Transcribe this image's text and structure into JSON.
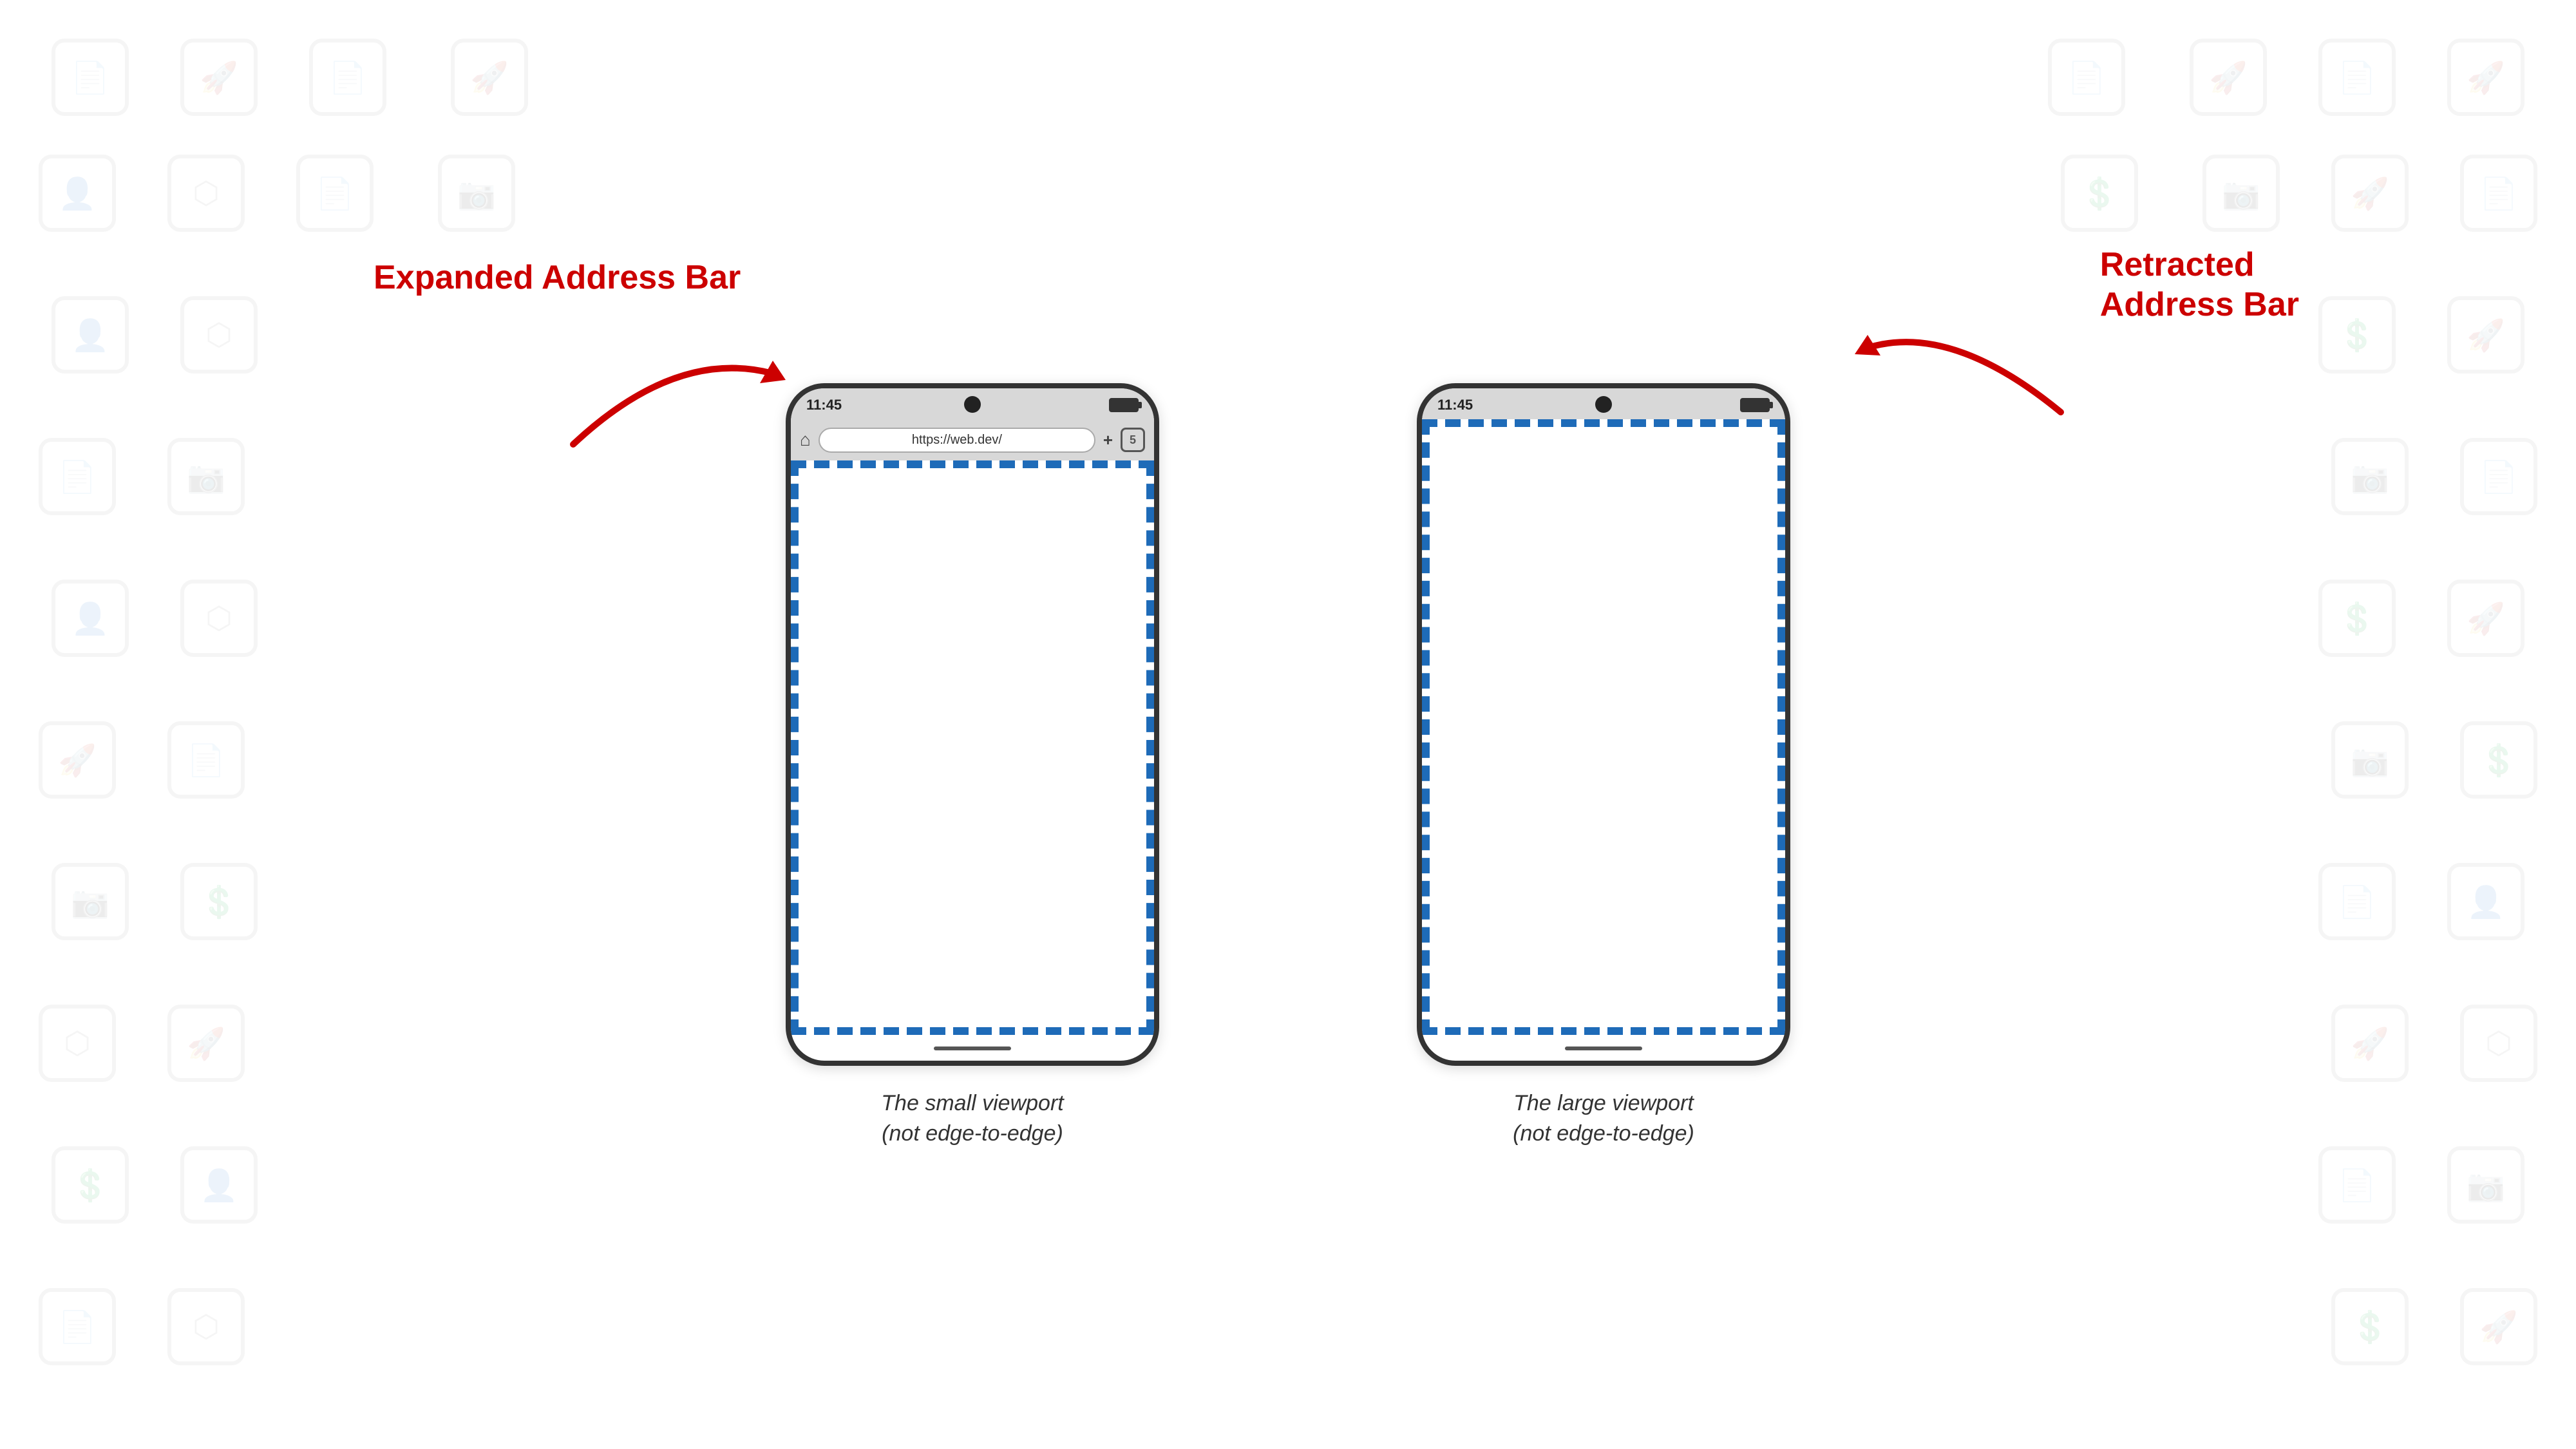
{
  "background": {
    "color": "#ffffff",
    "icon_opacity": 0.08
  },
  "left_phone": {
    "label": "Expanded\nAddress Bar",
    "time": "11:45",
    "url": "https://web.dev/",
    "tabs_count": "5",
    "caption_line1": "The small viewport",
    "caption_line2": "(not edge-to-edge)",
    "has_address_bar": true,
    "address_bar_visible": true
  },
  "right_phone": {
    "label": "Retracted\nAddress Bar",
    "time": "11:45",
    "caption_line1": "The large viewport",
    "caption_line2": "(not edge-to-edge)",
    "has_address_bar": false,
    "address_bar_visible": false
  },
  "annotations": {
    "left": "Expanded\nAddress Bar",
    "right": "Retracted\nAddress Bar"
  },
  "colors": {
    "dashed_border": "#1e6bb8",
    "annotation_text": "#cc0000",
    "phone_border": "#333333",
    "status_bar_bg": "#d8d8d8",
    "arrow_color": "#cc0000"
  }
}
